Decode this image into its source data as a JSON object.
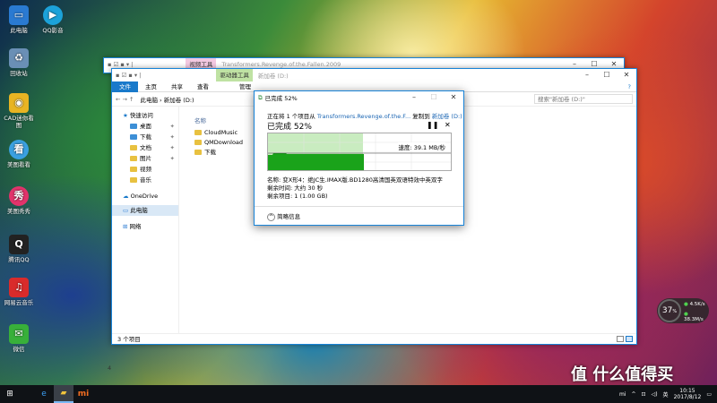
{
  "desktop_icons": [
    {
      "label": "此电脑",
      "icon": "computer-icon",
      "color": "#2a7ad2"
    },
    {
      "label": "QQ影音",
      "icon": "qqplayer-icon",
      "color": "#1ca2d9"
    },
    {
      "label": "回收站",
      "icon": "recycle-bin-icon",
      "color": "#6a8fb5"
    },
    {
      "label": "CAD迷你看图",
      "icon": "cad-viewer-icon",
      "color": "#e8b423"
    },
    {
      "label": "美图看看",
      "icon": "meitu-viewer-icon",
      "color": "#3aa0e0"
    },
    {
      "label": "美图秀秀",
      "icon": "meitu-xiuxiu-icon",
      "color": "#e2336b"
    },
    {
      "label": "腾讯QQ",
      "icon": "qq-icon",
      "color": "#222222"
    },
    {
      "label": "网易云音乐",
      "icon": "netease-music-icon",
      "color": "#d92b2b"
    },
    {
      "label": "微信",
      "icon": "wechat-icon",
      "color": "#38b03a"
    }
  ],
  "back_window": {
    "ctx_tab": "视频工具",
    "title": "Transformers.Revenge.of.the.Fallen.2009"
  },
  "explorer": {
    "ctx_tab": "驱动器工具",
    "title": "新加卷 (D:)",
    "tabs": [
      "文件",
      "主页",
      "共享",
      "查看",
      "管理"
    ],
    "address": "此电脑 › 新加卷 (D:)",
    "search_placeholder": "搜索\"新加卷 (D:)\"",
    "nav": {
      "quick_access": "快速访问",
      "items": [
        "桌面",
        "下载",
        "文档",
        "图片",
        "视频",
        "音乐"
      ],
      "onedrive": "OneDrive",
      "this_pc": "此电脑",
      "network": "网络"
    },
    "column_header": "名称",
    "files": [
      "CloudMusic",
      "QMDownload",
      "下载"
    ],
    "status": "3 个项目",
    "partial_left": "4"
  },
  "copy_dialog": {
    "title": "已完成 52%",
    "line_prefix": "正在将 1 个项目从",
    "source": "Transformers.Revenge.of.the.F...",
    "copy_to": "复制到",
    "dest": "新加卷 (D:)",
    "percent_label": "已完成 52%",
    "progress_percent": 52,
    "speed": "速度: 39.1 MB/秒",
    "name_line": "名称: 变X形4：绝JC生.IMAX版.BD1280高清国英双语特效中英双字",
    "time_left": "剩余时间: 大约 30 秒",
    "items_left": "剩余项目: 1 (1.00 GB)",
    "details": "简略信息"
  },
  "net_widget": {
    "percent": "37",
    "up": "4.5K/s",
    "down": "38.3M/s"
  },
  "taskbar": {
    "time": "10:15",
    "date": "2017/8/12",
    "ime": "英"
  },
  "watermark": "值 什么值得买"
}
